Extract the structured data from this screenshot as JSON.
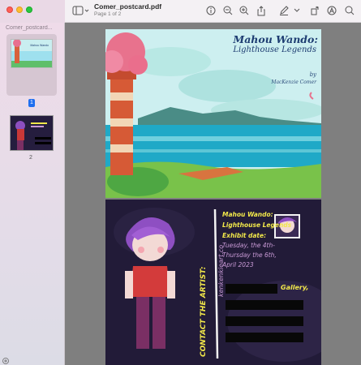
{
  "window": {
    "title": "Comer_postcard.pdf",
    "subtitle": "Page 1 of 2"
  },
  "toolbar": {
    "icons": [
      "sidebar-icon",
      "chevron-down-icon",
      "info-icon",
      "zoom-out-icon",
      "zoom-in-icon",
      "share-icon",
      "markup-pen-icon",
      "chevron-down-icon",
      "rotate-icon",
      "annotate-icon",
      "search-icon"
    ]
  },
  "sidebar": {
    "document_name": "Comer_postcard...",
    "pages": [
      {
        "label": "1",
        "selected": true
      },
      {
        "label": "2",
        "selected": false
      }
    ]
  },
  "page1": {
    "title": "Mahou Wando:",
    "subtitle": "Lighthouse Legends",
    "by": "by",
    "author": "MacKenzie Comer"
  },
  "page2": {
    "lines": [
      "Mahou Wando:",
      "Lighthouse Legends",
      "Exhibit date:"
    ],
    "dates": [
      "Tuesday, the 4th-",
      "Thursday the 6th,",
      "April 2023"
    ],
    "gallery": "Gallery,",
    "contact": "CONTACT THE ARTIST:",
    "website": "kenkenkieart.co"
  },
  "colors": {
    "accent": "#1f6ff0",
    "postcard_yellow": "#f2e84a",
    "postcard_purple": "#c99ad6"
  }
}
